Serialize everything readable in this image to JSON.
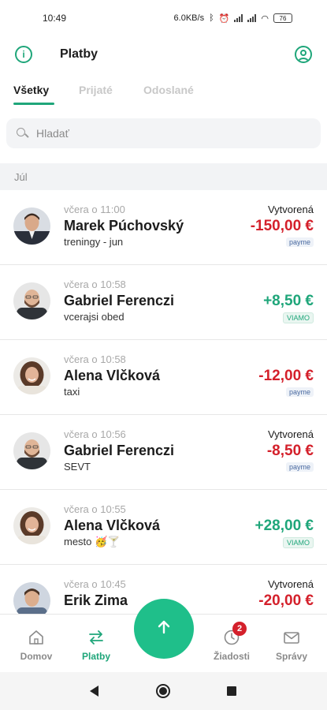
{
  "status_bar": {
    "time": "10:49",
    "net_speed": "6.0KB/s",
    "battery": "76"
  },
  "header": {
    "title": "Platby",
    "info_icon": "info-circle-icon",
    "profile_icon": "user-circle-icon"
  },
  "tabs": [
    {
      "label": "Všetky",
      "active": true
    },
    {
      "label": "Prijaté",
      "active": false
    },
    {
      "label": "Odoslané",
      "active": false
    }
  ],
  "search": {
    "placeholder": "Hladať"
  },
  "section": {
    "month": "Júl"
  },
  "payments": [
    {
      "time": "včera o 11:00",
      "name": "Marek Púchovský",
      "note": "treningy - jun",
      "status": "Vytvorená",
      "amount": "-150,00 €",
      "direction": "out",
      "provider": "payme"
    },
    {
      "time": "včera o 10:58",
      "name": "Gabriel Ferenczi",
      "note": "vcerajsi obed",
      "status": "",
      "amount": "+8,50 €",
      "direction": "in",
      "provider": "VIAMO"
    },
    {
      "time": "včera o 10:58",
      "name": "Alena Vlčková",
      "note": "taxi",
      "status": "",
      "amount": "-12,00 €",
      "direction": "out",
      "provider": "payme"
    },
    {
      "time": "včera o 10:56",
      "name": "Gabriel Ferenczi",
      "note": "SEVT",
      "status": "Vytvorená",
      "amount": "-8,50 €",
      "direction": "out",
      "provider": "payme"
    },
    {
      "time": "včera o 10:55",
      "name": "Alena Vlčková",
      "note": "mesto 🥳🍸",
      "status": "",
      "amount": "+28,00 €",
      "direction": "in",
      "provider": "VIAMO"
    },
    {
      "time": "včera o 10:45",
      "name": "Erik Zima",
      "note": "",
      "status": "Vytvorená",
      "amount": "-20,00 €",
      "direction": "out",
      "provider": ""
    }
  ],
  "bottom_nav": [
    {
      "label": "Domov",
      "icon": "home-icon",
      "active": false
    },
    {
      "label": "Platby",
      "icon": "transfer-arrows-icon",
      "active": true
    },
    {
      "label": "Žiadosti",
      "icon": "clock-request-icon",
      "active": false,
      "badge": "2"
    },
    {
      "label": "Správy",
      "icon": "envelope-icon",
      "active": false
    }
  ],
  "fab": {
    "icon": "arrow-up-icon"
  },
  "colors": {
    "accent": "#1fa67a",
    "fab": "#1fbf8a",
    "negative": "#d4202b",
    "positive": "#1fa67a"
  }
}
